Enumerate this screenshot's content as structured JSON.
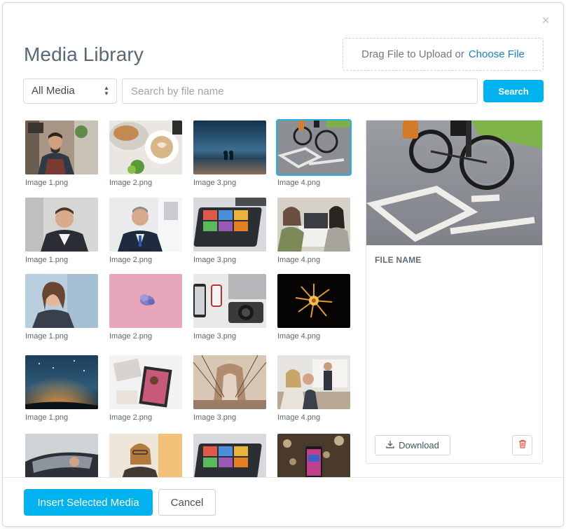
{
  "modal": {
    "title": "Media Library",
    "close_glyph": "×",
    "upload": {
      "prompt": "Drag File to Upload or",
      "choose_label": "Choose File"
    },
    "filter": {
      "selected": "All Media"
    },
    "search": {
      "placeholder": "Search by file name",
      "value": "",
      "button_label": "Search"
    }
  },
  "grid": {
    "rows": [
      [
        "Image 1.png",
        "Image 2.png",
        "Image 3.png",
        "Image 4.png"
      ],
      [
        "Image 1.png",
        "Image 2.png",
        "Image 3.png",
        "Image 4.png"
      ],
      [
        "Image 1.png",
        "Image 2.png",
        "Image 3.png",
        "Image 4.png"
      ],
      [
        "Image 1.png",
        "Image 2.png",
        "Image 3.png",
        "Image 4.png"
      ],
      [
        "",
        "",
        "",
        ""
      ]
    ],
    "selected_index": 3
  },
  "preview": {
    "file_name_label": "FILE NAME",
    "download_label": "Download"
  },
  "footer": {
    "insert_label": "Insert Selected Media",
    "cancel_label": "Cancel"
  },
  "colors": {
    "accent": "#00b3ee",
    "link": "#1e7cc8",
    "selected_outline": "#26b0e6",
    "delete_icon": "#e0513f"
  }
}
